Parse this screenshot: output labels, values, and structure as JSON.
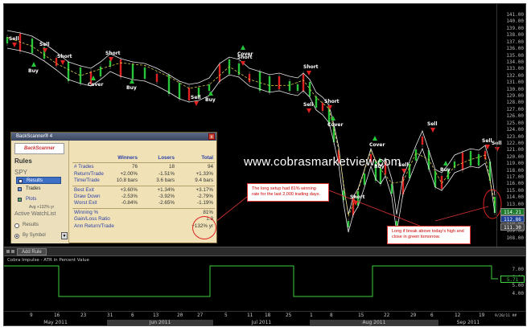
{
  "chart": {
    "signals": [
      {
        "label": "Sell",
        "dir": "down"
      },
      {
        "label": "Sell",
        "dir": "down"
      },
      {
        "label": "Buy",
        "dir": "up"
      },
      {
        "label": "Short",
        "dir": "down"
      },
      {
        "label": "Cover",
        "dir": "up"
      },
      {
        "label": "Short",
        "dir": "down"
      },
      {
        "label": "Buy",
        "dir": "up"
      },
      {
        "label": "Sell",
        "dir": "down"
      },
      {
        "label": "Buy",
        "dir": "up"
      },
      {
        "label": "Short",
        "dir": "down"
      },
      {
        "label": "Cover",
        "dir": "up"
      },
      {
        "label": "Short",
        "dir": "down"
      },
      {
        "label": "Sell",
        "dir": "down"
      },
      {
        "label": "Short",
        "dir": "down"
      },
      {
        "label": "Cover",
        "dir": "up"
      },
      {
        "label": "Short",
        "dir": "down"
      },
      {
        "label": "Cover",
        "dir": "up"
      },
      {
        "label": "Buy",
        "dir": "up"
      },
      {
        "label": "Sell",
        "dir": "down"
      },
      {
        "label": "Sell",
        "dir": "down"
      },
      {
        "label": "Buy",
        "dir": "up"
      },
      {
        "label": "Sell",
        "dir": "down"
      },
      {
        "label": "Sell",
        "dir": "down"
      }
    ],
    "watermark": "www.cobrasmarketview.com",
    "callout_left": "The long setup had 81% winning rate  for the last 2,000 trading days.",
    "callout_right": "Long if break above today's high and close in green tomorrow.",
    "last_price": "114.21",
    "flag_price": "112.86",
    "flag_price2": "111.30"
  },
  "panel": {
    "title": "BackScanner® 4",
    "close": "x",
    "logo": "BackScanner",
    "rules_heading": "Rules",
    "symbol": "SPY",
    "results_btn": "Results",
    "trades_btn": "Trades",
    "plots_btn": "Plots",
    "avg_note": "Avg +132% yr",
    "watchlist_heading": "Active WatchList",
    "radio_results": "Results",
    "radio_symbol": "By Symbol",
    "headers": [
      "Winners",
      "Losers",
      "Total"
    ],
    "rows": [
      {
        "label": "# Trades",
        "v": [
          "76",
          "18",
          "94"
        ]
      },
      {
        "label": "Return/Trade",
        "v": [
          "+2.00%",
          "-1.51%",
          "+1.33%"
        ]
      },
      {
        "label": "Time/Trade",
        "v": [
          "10.8 bars",
          "3.6 bars",
          "9.4 bars"
        ]
      },
      {
        "label": "Best Exit",
        "v": [
          "+3.60%",
          "+1.34%",
          "+3.17%"
        ]
      },
      {
        "label": "Draw Down",
        "v": [
          "-2.53%",
          "-3.92%",
          "-2.79%"
        ]
      },
      {
        "label": "Worst Exit",
        "v": [
          "-0.84%",
          "-2.65%",
          "-1.19%"
        ]
      },
      {
        "label": "Winning %",
        "v": [
          "",
          "",
          "81%"
        ]
      },
      {
        "label": "Gain/Loss Ratio",
        "v": [
          "",
          "",
          "1.3"
        ]
      },
      {
        "label": "Ann Return/Trade",
        "v": [
          "",
          "",
          "+132% yr"
        ]
      }
    ]
  },
  "toolbar": {
    "add_rule": "Add Rule"
  },
  "indicator": {
    "label": "Cobra Impulse - ATR in Percent Value",
    "last_value": "5.71"
  },
  "price_ticks": [
    "141.00",
    "140.00",
    "139.00",
    "138.00",
    "137.00",
    "136.00",
    "135.00",
    "134.00",
    "133.00",
    "132.00",
    "131.00",
    "130.00",
    "129.00",
    "128.00",
    "127.00",
    "126.00",
    "125.00",
    "124.00",
    "123.00",
    "122.00",
    "121.00",
    "120.00",
    "119.00",
    "118.00",
    "117.00",
    "116.00",
    "115.00",
    "114.00",
    "113.00",
    "112.00",
    "111.00",
    "110.00",
    "109.00",
    "108.00"
  ],
  "indicator_ticks": [
    "7.00",
    "6.00",
    "5.00",
    "4.00"
  ],
  "date_axis": {
    "days": [
      "9",
      "16",
      "23",
      "31",
      "6",
      "13",
      "20",
      "27",
      "5",
      "11",
      "18",
      "25",
      "1",
      "8",
      "15",
      "22",
      "29",
      "6",
      "12",
      "19",
      "9/20/11 ##"
    ],
    "months": [
      "May 2011",
      "Jun 2011",
      "Jul 2011",
      "Aug 2011",
      "Sep 2011"
    ]
  }
}
